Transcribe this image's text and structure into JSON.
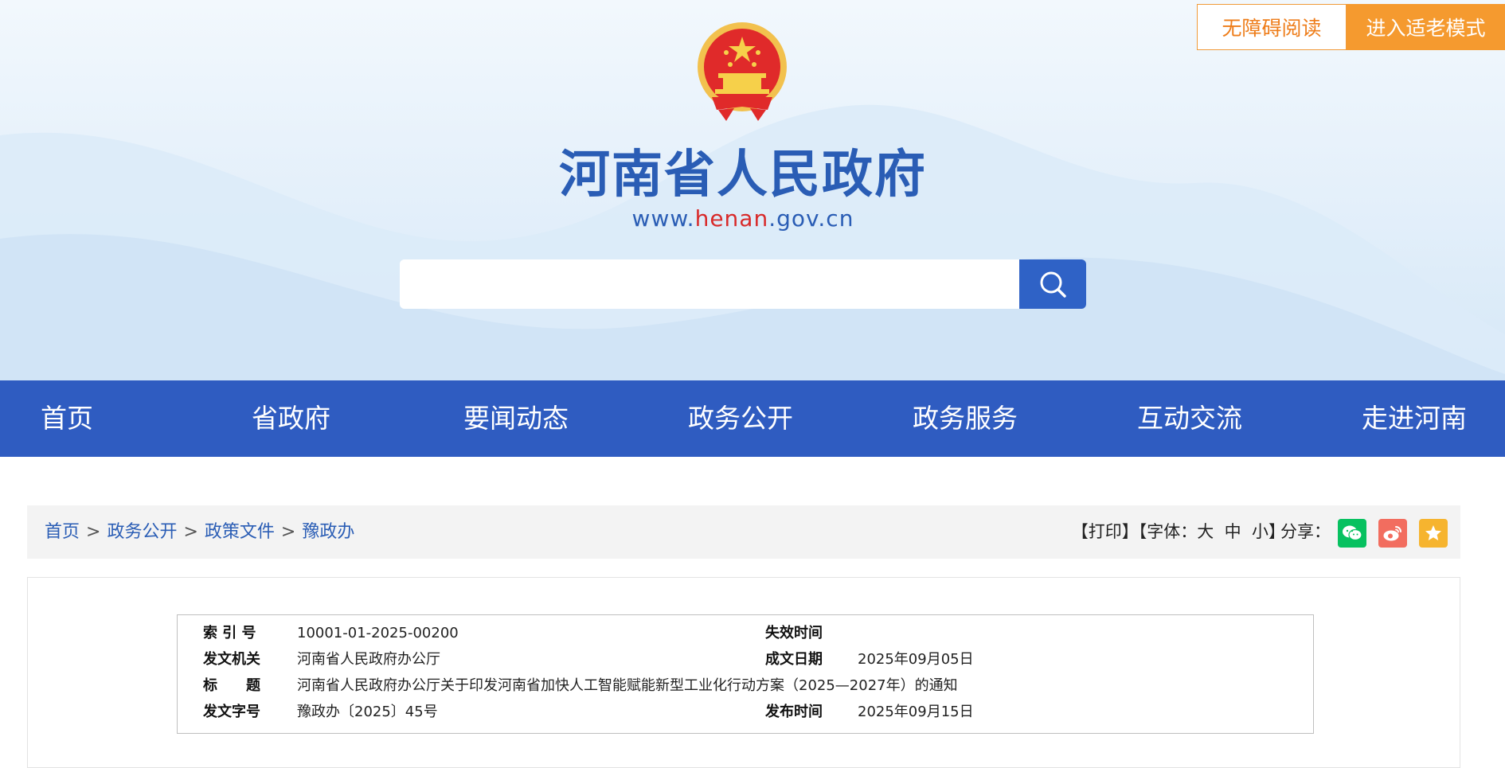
{
  "accessibility": {
    "barrier_free_label": "无障碍阅读",
    "elder_mode_label": "进入适老模式"
  },
  "header": {
    "title": "河南省人民政府",
    "url_prefix": "www.",
    "url_highlight": "henan",
    "url_suffix": ".gov.cn",
    "search_placeholder": ""
  },
  "nav": {
    "items": [
      "首页",
      "省政府",
      "要闻动态",
      "政务公开",
      "政务服务",
      "互动交流",
      "走进河南"
    ]
  },
  "breadcrumb": {
    "items": [
      "首页",
      "政务公开",
      "政策文件",
      "豫政办"
    ],
    "separator": ">"
  },
  "tools": {
    "print": "【打印】",
    "font_prefix": "【字体：",
    "font_large": "大",
    "font_medium": "中",
    "font_small": "小",
    "font_suffix": "】",
    "share_label": "分享："
  },
  "meta": {
    "index_label": "索 引 号",
    "index_value": "10001-01-2025-00200",
    "expire_label": "失效时间",
    "expire_value": "",
    "issuer_label": "发文机关",
    "issuer_value": "河南省人民政府办公厅",
    "created_label": "成文日期",
    "created_value": "2025年09月05日",
    "title_label": "标　　题",
    "title_value": "河南省人民政府办公厅关于印发河南省加快人工智能赋能新型工业化行动方案（2025—2027年）的通知",
    "docno_label": "发文字号",
    "docno_value": "豫政办〔2025〕45号",
    "publish_label": "发布时间",
    "publish_value": "2025年09月15日"
  },
  "colors": {
    "nav_bg": "#2f5cc1",
    "title_blue": "#2a5db5",
    "url_red": "#d82a2a",
    "elder_orange": "#f59a2f",
    "wechat_green": "#07c160",
    "weibo_red": "#f26d5f",
    "favorite_yellow": "#f6b42f"
  }
}
